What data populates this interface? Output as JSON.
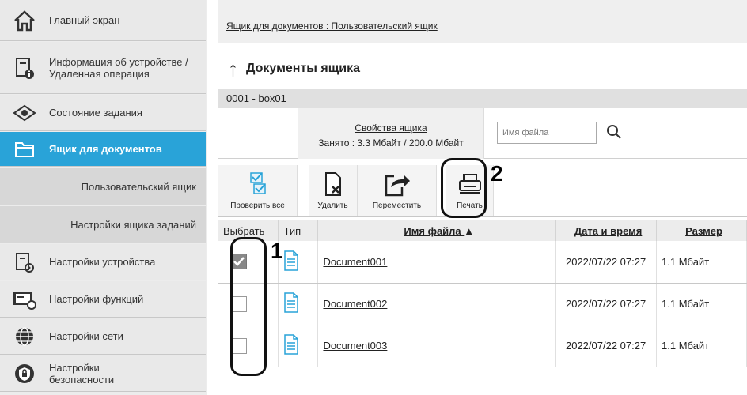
{
  "sidebar": {
    "items": [
      {
        "label": "Главный экран",
        "icon": "home-icon"
      },
      {
        "label": "Информация об устройстве / Удаленная операция",
        "icon": "device-info-icon"
      },
      {
        "label": "Состояние задания",
        "icon": "job-status-icon"
      },
      {
        "label": "Ящик для документов",
        "icon": "document-box-icon",
        "active": true
      },
      {
        "label": "Пользовательский ящик"
      },
      {
        "label": "Настройки ящика заданий"
      },
      {
        "label": "Настройки устройства",
        "icon": "device-settings-icon"
      },
      {
        "label": "Настройки функций",
        "icon": "function-settings-icon"
      },
      {
        "label": "Настройки сети",
        "icon": "network-icon"
      },
      {
        "label": "Настройки безопасности",
        "icon": "shield-icon"
      }
    ]
  },
  "main": {
    "breadcrumb": "Ящик для документов : Пользовательский ящик",
    "title": "Документы ящика",
    "box_name": "0001 - box01",
    "properties_link": "Свойства ящика",
    "usage": "Занято : 3.3 Мбайт / 200.0 Мбайт",
    "search_placeholder": "Имя файла",
    "toolbar": {
      "check_all": "Проверить все",
      "delete": "Удалить",
      "move": "Переместить",
      "print": "Печать"
    },
    "table": {
      "headers": {
        "select": "Выбрать",
        "type": "Тип",
        "filename": "Имя файла",
        "datetime": "Дата и время",
        "size": "Размер"
      },
      "rows": [
        {
          "name": "Document001",
          "datetime": "2022/07/22 07:27",
          "size": "1.1 Мбайт",
          "checked": true
        },
        {
          "name": "Document002",
          "datetime": "2022/07/22 07:27",
          "size": "1.1 Мбайт",
          "checked": false
        },
        {
          "name": "Document003",
          "datetime": "2022/07/22 07:27",
          "size": "1.1 Мбайт",
          "checked": false
        }
      ]
    }
  },
  "callouts": {
    "one": "1",
    "two": "2"
  },
  "colors": {
    "active_nav": "#29a3d8",
    "doc_icon": "#29a3d8"
  }
}
